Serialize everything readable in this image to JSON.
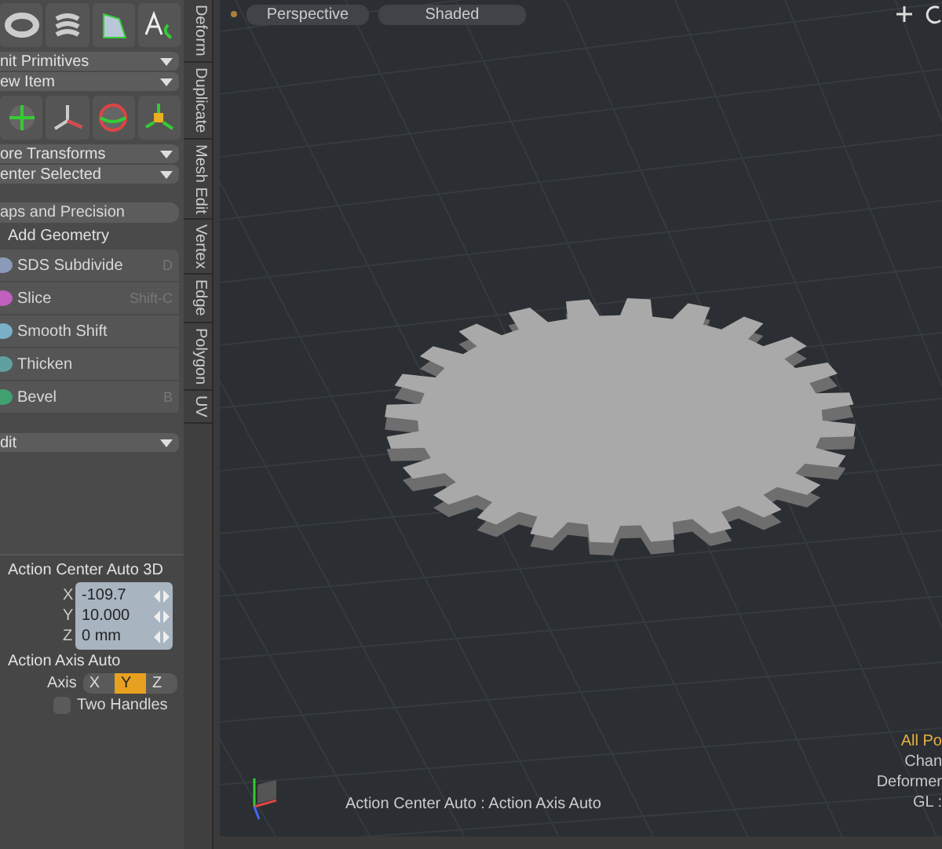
{
  "toolbox": {
    "top_dropdowns": [
      "nit Primitives",
      "ew Item"
    ],
    "mid_dropdowns": [
      "ore Transforms",
      "enter Selected"
    ],
    "precision_button": "aps and Precision",
    "section": "Add Geometry",
    "tools": [
      {
        "label": "SDS Subdivide",
        "shortcut": "D",
        "color": "#8a9ab8"
      },
      {
        "label": "Slice",
        "shortcut": "Shift-C",
        "color": "#c060c0"
      },
      {
        "label": "Smooth Shift",
        "color": "#7ab0c8"
      },
      {
        "label": "Thicken",
        "color": "#60a0a0"
      },
      {
        "label": "Bevel",
        "shortcut": "B",
        "color": "#40a070"
      }
    ],
    "bottom_dropdown": "dit"
  },
  "side_tabs": [
    "Deform",
    "Duplicate",
    "Mesh Edit",
    "Vertex",
    "Edge",
    "Polygon",
    "UV"
  ],
  "properties": {
    "center_title": "Action Center Auto 3D",
    "fields": [
      {
        "axis": "X",
        "value": "-109.7"
      },
      {
        "axis": "Y",
        "value": "10.000"
      },
      {
        "axis": "Z",
        "value": "0 mm"
      }
    ],
    "axis_title": "Action Axis Auto",
    "axis_label": "Axis",
    "axis_options": [
      {
        "label": "X",
        "selected": false
      },
      {
        "label": "Y",
        "selected": true
      },
      {
        "label": "Z",
        "selected": false
      }
    ],
    "two_handles": {
      "label": "Two Handles",
      "checked": false
    }
  },
  "viewport": {
    "view": "Perspective",
    "shading": "Shaded",
    "status": "Action Center Auto : Action Axis Auto",
    "info": [
      {
        "text": "All Po",
        "color": "#e8b040"
      },
      {
        "text": "Chan",
        "color": "#c8c8c8"
      },
      {
        "text": "Deformer",
        "color": "#c8c8c8"
      },
      {
        "text": "GL :",
        "color": "#c8c8c8"
      }
    ]
  }
}
